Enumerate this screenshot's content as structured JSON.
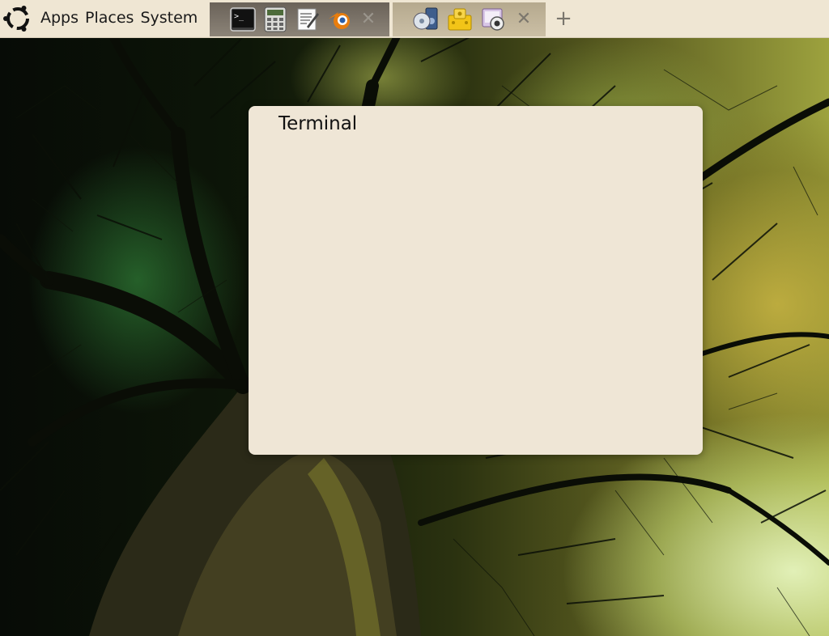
{
  "panel": {
    "menu": [
      "Apps",
      "Places",
      "System"
    ],
    "launchers_left": [
      {
        "icon": "terminal-icon"
      },
      {
        "icon": "calculator-icon"
      },
      {
        "icon": "text-editor-icon"
      },
      {
        "icon": "blender-icon"
      }
    ],
    "launchers_right": [
      {
        "icon": "system-monitor-icon"
      },
      {
        "icon": "package-manager-icon"
      },
      {
        "icon": "webcam-icon"
      }
    ],
    "close_symbol": "✕",
    "add_symbol": "+"
  },
  "window": {
    "title": "Terminal"
  }
}
